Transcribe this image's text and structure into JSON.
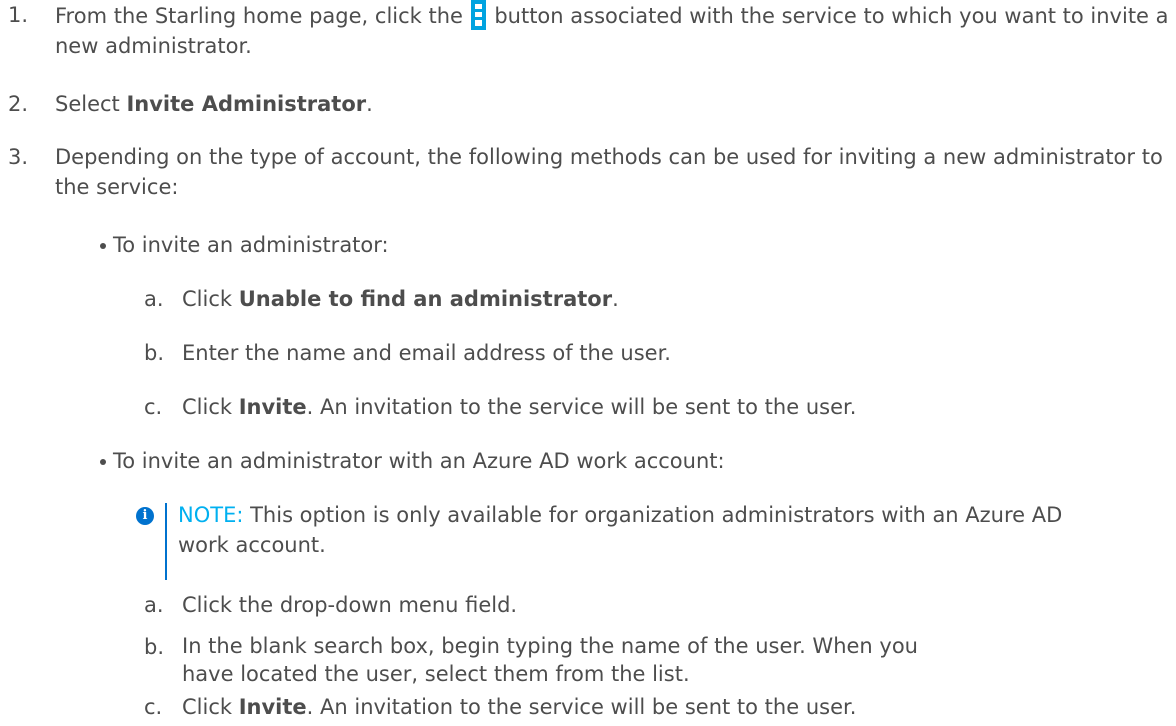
{
  "steps": [
    {
      "number": "1.",
      "text_before_icon": "From the Starling home page, click the ",
      "icon": "vertical-ellipsis-menu-icon",
      "text_after_icon": " button associated with the service to which you want to invite a new administrator."
    },
    {
      "number": "2.",
      "text_before": "Select ",
      "bold": "Invite Administrator",
      "text_after": "."
    },
    {
      "number": "3.",
      "text": "Depending on the type of account, the following methods can be used for inviting a new administrator to the service:"
    }
  ],
  "bullets": [
    {
      "text": "To invite an administrator:",
      "substeps": [
        {
          "letter": "a.",
          "text_before": "Click ",
          "bold": "Unable to find an administrator",
          "text_after": "."
        },
        {
          "letter": "b.",
          "text": "Enter the name and email address of the user."
        },
        {
          "letter": "c.",
          "text_before": "Click ",
          "bold": "Invite",
          "text_after": ". An invitation to the service will be sent to the user."
        }
      ]
    },
    {
      "text": "To invite an administrator with an Azure AD work account:",
      "note": {
        "label": "NOTE:",
        "text": " This option is only available for organization administrators with an Azure AD work account."
      },
      "substeps": [
        {
          "letter": "a.",
          "text": "Click the drop-down menu field."
        },
        {
          "letter": "b.",
          "text_line1": "In the blank search box, begin typing the name of the user. When you",
          "text_line2": "have located the user, select them from the list."
        },
        {
          "letter": "c.",
          "text_before": "Click ",
          "bold": "Invite",
          "text_after": ". An invitation to the service will be sent to the user."
        }
      ]
    }
  ],
  "colors": {
    "text": "#4d4d4d",
    "note_label": "#00b0f0",
    "note_bar": "#0072ce",
    "icon": "#00a3e0"
  }
}
